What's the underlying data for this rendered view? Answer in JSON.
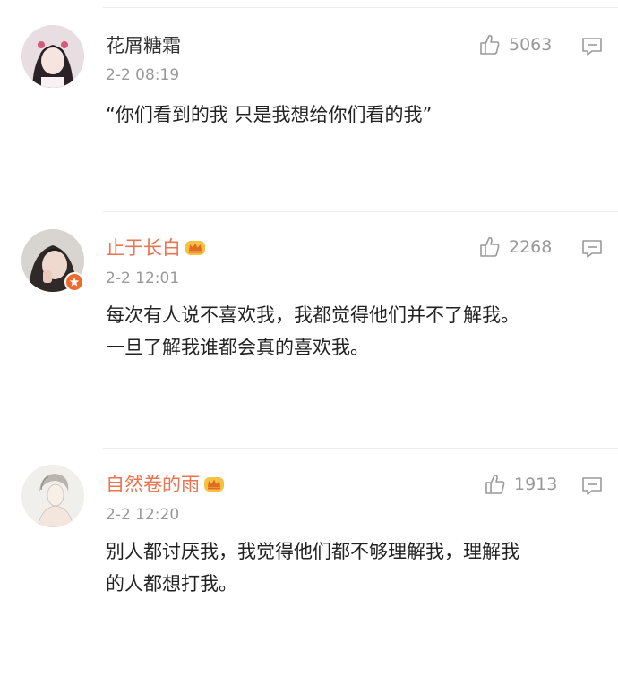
{
  "comments": [
    {
      "username": "花屑糖霜",
      "time": "2-2 08:19",
      "likes": "5063",
      "text": "“你们看到的我  只是我想给你们看的我”",
      "vip": false,
      "verified": false
    },
    {
      "username": "止于长白",
      "time": "2-2 12:01",
      "likes": "2268",
      "text": "每次有人说不喜欢我，我都觉得他们并不了解我。\n一旦了解我谁都会真的喜欢我。",
      "vip": true,
      "verified": true
    },
    {
      "username": "自然卷的雨",
      "time": "2-2 12:20",
      "likes": "1913",
      "text": "别人都讨厌我，我觉得他们都不够理解我，理解我\n的人都想打我。",
      "vip": true,
      "verified": false
    }
  ],
  "colors": {
    "vip_name": "#eb7350",
    "meta": "#999999",
    "badge": "#f06a2c"
  },
  "icons": {
    "like": "thumbs-up-icon",
    "reply": "comment-icon",
    "crown": "vip-crown-icon"
  }
}
